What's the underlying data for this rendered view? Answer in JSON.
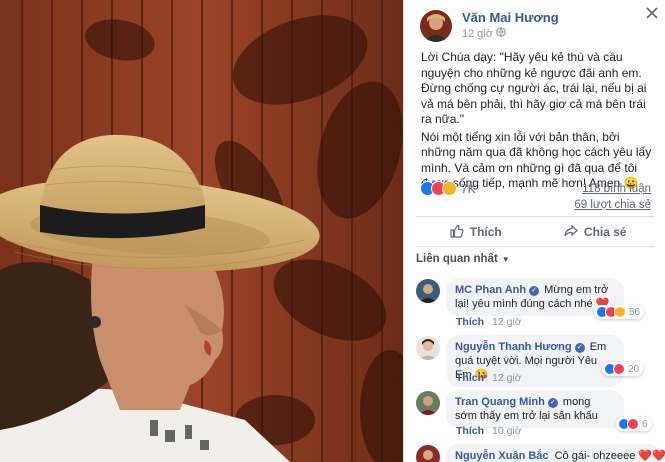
{
  "post": {
    "author": "Văn Mai Hương",
    "time": "12 giờ",
    "text": [
      "Lời Chúa dạy: \"Hãy yêu kẻ thù và cầu nguyện cho những kẻ ngược đãi anh em. Đừng chống cự người ác, trái lại, nếu bị ai vả má bên phải, thì hãy giơ cả má bên trái ra nữa.\"",
      "Nói một tiếng xin lỗi với bản thân, bởi những năm qua đã không học cách yêu lấy mình. Và cảm ơn những gì đã qua để tôi được sống tiếp, mạnh mẽ hơn! Amen 😀"
    ],
    "reaction_count": "7K",
    "comments_count": "118 bình luận",
    "shares_count": "69 lượt chia sẻ"
  },
  "actions": {
    "like": "Thích",
    "share": "Chia sẻ"
  },
  "sort_label": "Liên quan nhất",
  "comments": [
    {
      "author": "MC Phan Anh",
      "verified": true,
      "text": "Mừng em trở lại! yêu mình đúng cách nhé ❤️",
      "like_label": "Thích",
      "time": "12 giờ",
      "reactions": "56"
    },
    {
      "author": "Nguyễn Thanh Hương",
      "verified": true,
      "text": "Em quá tuyệt vời. Mọi người Yêu Em 😘",
      "like_label": "Thích",
      "time": "12 giờ",
      "reactions": "20"
    },
    {
      "author": "Tran Quang Minh",
      "verified": true,
      "text": "mong sớm thấy em trở lại sân khấu",
      "like_label": "Thích",
      "time": "10 giờ",
      "reactions": "6"
    },
    {
      "author": "Nguyễn Xuân Bắc",
      "verified": false,
      "text": "Cô gái- ohzeeee ❤️❤️",
      "like_label": "",
      "time": "",
      "reactions": ""
    }
  ],
  "colors": {
    "link": "#385898",
    "like_blue": "#1877f2",
    "love_red": "#f33e58",
    "haha_yellow": "#f7b125"
  }
}
